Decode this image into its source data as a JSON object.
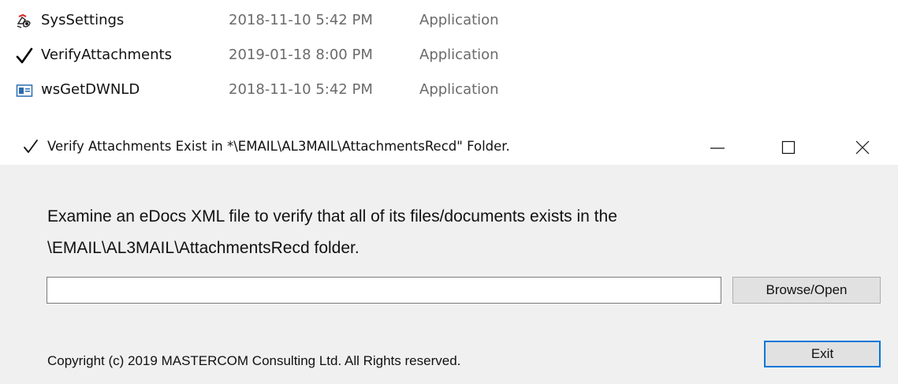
{
  "file_list": [
    {
      "name": "SysSettings",
      "date": "2018-11-10 5:42 PM",
      "type": "Application",
      "icon": "settings-app-icon"
    },
    {
      "name": "VerifyAttachments",
      "date": "2019-01-18 8:00 PM",
      "type": "Application",
      "icon": "checkmark-icon"
    },
    {
      "name": "wsGetDWNLD",
      "date": "2018-11-10 5:42 PM",
      "type": "Application",
      "icon": "window-app-icon"
    }
  ],
  "window": {
    "title": "Verify Attachments Exist in *\\EMAIL\\AL3MAIL\\AttachmentsRecd\" Folder.",
    "icon": "checkmark-icon"
  },
  "dialog": {
    "description_line1": "Examine an eDocs XML file to verify that all of its files/documents exists in the",
    "description_line2": "\\EMAIL\\AL3MAIL\\AttachmentsRecd folder.",
    "path_value": "",
    "browse_label": "Browse/Open",
    "copyright": "Copyright (c) 2019 MASTERCOM Consulting Ltd. All Rights reserved.",
    "exit_label": "Exit"
  },
  "colors": {
    "dialog_background": "#f0f0f0",
    "button_background": "#e1e1e1",
    "focus_border": "#0078d7",
    "secondary_text": "#6b6b6b"
  }
}
